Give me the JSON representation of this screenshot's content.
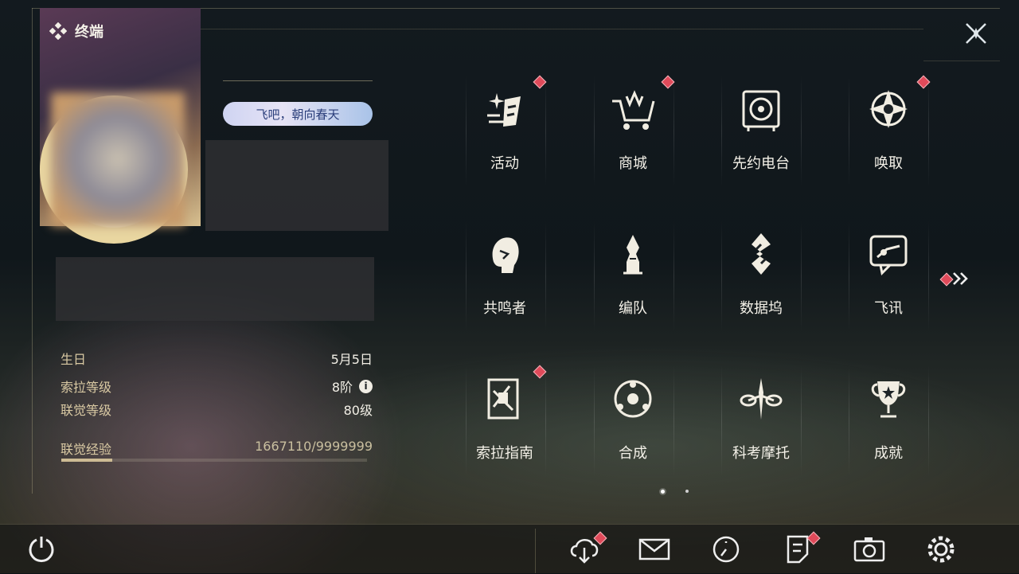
{
  "header": {
    "title": "终端"
  },
  "profile": {
    "badge_text": "飞吧，朝向春天"
  },
  "info": {
    "birthday_label": "生日",
    "birthday_value": "5月5日",
    "sora_level_label": "索拉等级",
    "sora_level_value": "8阶",
    "union_level_label": "联觉等级",
    "union_level_value": "80级",
    "union_exp_label": "联觉经验",
    "union_exp_value": "1667110/9999999",
    "union_exp_fraction": 0.1667
  },
  "grid": {
    "items": [
      {
        "label": "活动",
        "icon": "activity-icon",
        "badge": true
      },
      {
        "label": "商城",
        "icon": "shop-cart-icon",
        "badge": true
      },
      {
        "label": "先约电台",
        "icon": "radio-icon",
        "badge": false
      },
      {
        "label": "唤取",
        "icon": "convene-icon",
        "badge": true
      },
      {
        "label": "共鸣者",
        "icon": "resonator-icon",
        "badge": false
      },
      {
        "label": "编队",
        "icon": "team-chess-icon",
        "badge": false
      },
      {
        "label": "数据坞",
        "icon": "databank-icon",
        "badge": false
      },
      {
        "label": "飞讯",
        "icon": "message-icon",
        "badge": false
      },
      {
        "label": "索拉指南",
        "icon": "guidebook-icon",
        "badge": true
      },
      {
        "label": "合成",
        "icon": "synthesis-icon",
        "badge": false
      },
      {
        "label": "科考摩托",
        "icon": "motorcycle-icon",
        "badge": false
      },
      {
        "label": "成就",
        "icon": "trophy-icon",
        "badge": false
      }
    ]
  },
  "bottom": {
    "icons": [
      "power-icon",
      "download-icon",
      "mail-icon",
      "clock-icon",
      "notice-icon",
      "camera-icon",
      "settings-icon"
    ]
  },
  "colors": {
    "accent": "#e04a5a",
    "gold": "#d9c9a3"
  }
}
